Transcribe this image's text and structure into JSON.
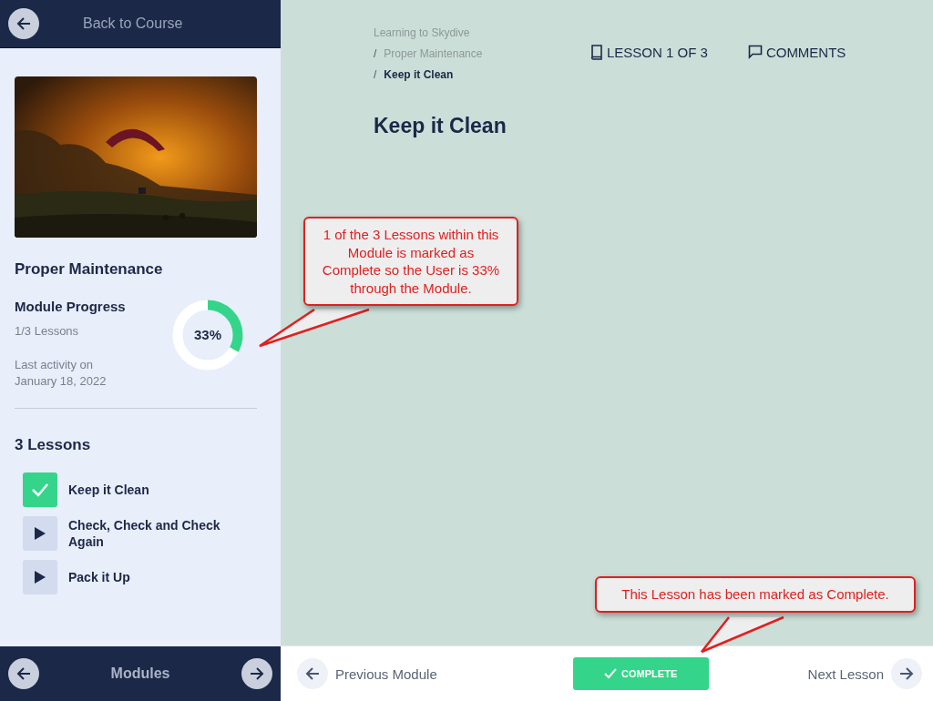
{
  "sidebar": {
    "back_label": "Back to Course",
    "module_title": "Proper Maintenance",
    "progress": {
      "heading": "Module Progress",
      "count": "1/3 Lessons",
      "level": 0.33,
      "percent": "33%",
      "last_activity": "Last activity on January 18, 2022"
    },
    "lessons_heading": "3 Lessons",
    "lessons": [
      {
        "title": "Keep it Clean",
        "completed": true
      },
      {
        "title": "Check, Check and Check Again",
        "completed": false
      },
      {
        "title": "Pack it Up",
        "completed": false
      }
    ],
    "footer": {
      "label": "Modules"
    }
  },
  "breadcrumb": [
    {
      "label": "Learning to Skydive",
      "current": false
    },
    {
      "separator": "/",
      "label": "Proper Maintenance",
      "current": false
    },
    {
      "separator": "/",
      "label": "Keep it Clean",
      "current": true
    }
  ],
  "lesson_counter": "LESSON 1 OF 3",
  "comments": "COMMENTS",
  "title": "Keep it Clean",
  "footer": {
    "previous": "Previous Module",
    "complete": "COMPLETE",
    "completed": true,
    "next": "Next Lesson"
  },
  "callouts": [
    {
      "text": "1 of the 3 Lessons within this Module is marked as Complete so the User is 33% through the Module.",
      "kind": "progress"
    },
    {
      "text": "This Lesson has been marked as Complete.",
      "kind": "complete"
    }
  ]
}
